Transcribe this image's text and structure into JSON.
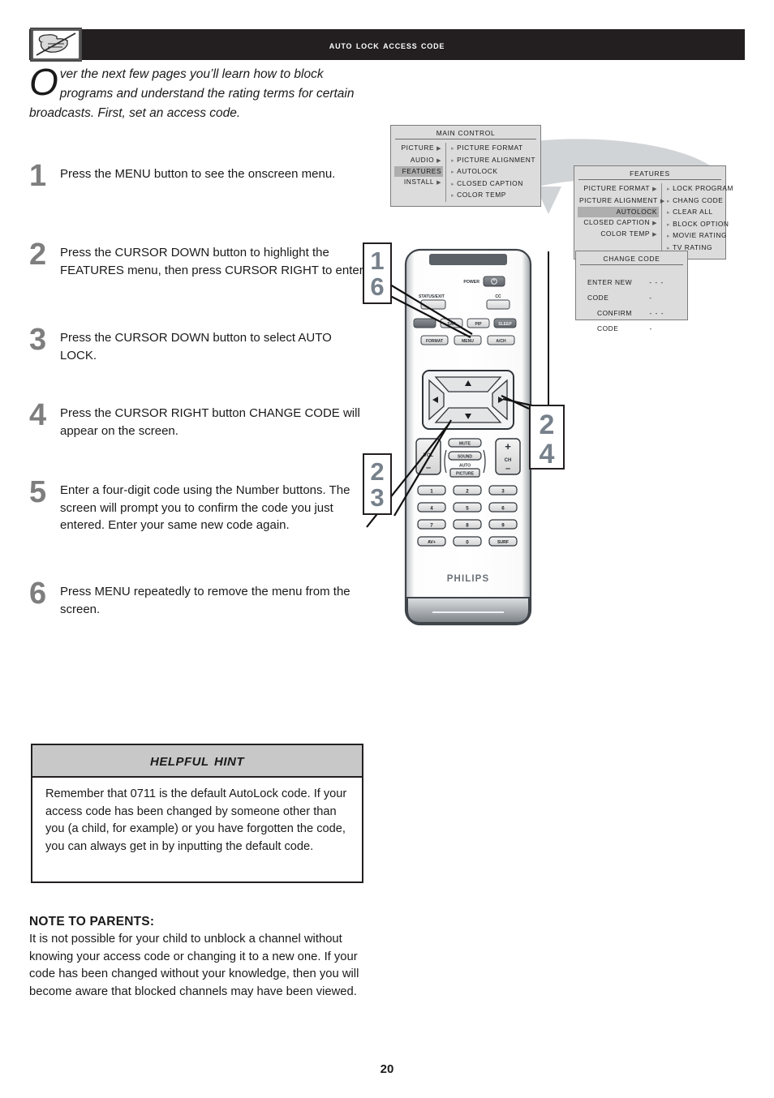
{
  "header": {
    "title": "Auto Lock Access Code",
    "icon": "no-touch-tv-hand-icon"
  },
  "intro": {
    "dropcap": "O",
    "text": "ver the next few pages you’ll learn how to block programs and understand the rating terms for certain broadcasts. First, set an access code."
  },
  "steps": [
    {
      "num": "1",
      "text": "Press the MENU  button to see the onscreen menu."
    },
    {
      "num": "2",
      "text": "Press the CURSOR DOWN button to highlight the FEATURES menu, then press CURSOR RIGHT to enter."
    },
    {
      "num": "3",
      "text": "Press the CURSOR DOWN button to select AUTO LOCK."
    },
    {
      "num": "4",
      "text": "Press the CURSOR RIGHT button CHANGE CODE will appear on the screen."
    },
    {
      "num": "5",
      "text": "Enter a four-digit code using the Number buttons. The screen will prompt you to confirm the code you just entered. Enter your same new code again."
    },
    {
      "num": "6",
      "text": "Press MENU repeatedly to remove the menu from the screen."
    }
  ],
  "osd": {
    "main_control": {
      "title": "MAIN CONTROL",
      "left_items": [
        {
          "label": "PICTURE",
          "arrow": true,
          "selected": false
        },
        {
          "label": "AUDIO",
          "arrow": true,
          "selected": false
        },
        {
          "label": "FEATURES",
          "arrow": false,
          "selected": true
        },
        {
          "label": "INSTALL",
          "arrow": true,
          "selected": false
        }
      ],
      "right_items": [
        "PICTURE FORMAT",
        "PICTURE ALIGNMENT",
        "AUTOLOCK",
        "CLOSED CAPTION",
        "COLOR TEMP"
      ]
    },
    "features": {
      "title": "FEATURES",
      "left_items": [
        {
          "label": "PICTURE FORMAT",
          "arrow": true,
          "selected": false
        },
        {
          "label": "PICTURE ALIGNMENT",
          "arrow": true,
          "selected": false
        },
        {
          "label": "AUTOLOCK",
          "arrow": false,
          "selected": true
        },
        {
          "label": "CLOSED CAPTION",
          "arrow": true,
          "selected": false
        },
        {
          "label": "COLOR TEMP",
          "arrow": true,
          "selected": false
        }
      ],
      "right_items": [
        "LOCK PROGRAM",
        "CHANG CODE",
        "CLEAR ALL",
        "BLOCK OPTION",
        "MOVIE RATING",
        "TV RATING"
      ]
    },
    "change_code": {
      "title": "CHANGE CODE",
      "rows": [
        {
          "label": "ENTER NEW CODE",
          "value": "- - - -"
        },
        {
          "label": "CONFIRM CODE",
          "value": "- - - -"
        }
      ]
    }
  },
  "callouts": [
    {
      "id": "callout-16",
      "lines": [
        "1",
        "6"
      ]
    },
    {
      "id": "callout-23",
      "lines": [
        "2",
        "3"
      ]
    },
    {
      "id": "callout-24",
      "lines": [
        "2",
        "4"
      ]
    }
  ],
  "remote": {
    "brand": "PHILIPS",
    "power_label": "POWER",
    "status_label": "STATUS/EXIT",
    "cc_label": "CC",
    "row_mid": [
      "SAP",
      "PIP",
      "SLEEP"
    ],
    "row_fn": [
      "FORMAT",
      "MENU",
      "A/CH"
    ],
    "mute": "MUTE",
    "sound": "SOUND",
    "auto": "AUTO",
    "picture": "PICTURE",
    "vol": "VOL",
    "ch": "CH",
    "plus": "+",
    "minus": "–",
    "keypad": [
      "1",
      "2",
      "3",
      "4",
      "5",
      "6",
      "7",
      "8",
      "9",
      "AV+",
      "0",
      "SURF"
    ],
    "cursor": {
      "up": "▲",
      "down": "▼",
      "left": "◀",
      "right": "▶"
    }
  },
  "hint": {
    "title": "Helpful Hint",
    "body": "Remember that 0711 is the default AutoLock code. If your access code has been changed by someone other than you (a child, for example) or you have forgotten the code, you can always get in by inputting the default code."
  },
  "note": {
    "title": "NOTE TO PARENTS:",
    "body": "It is not possible for your child to unblock a channel without knowing your access code or changing it to a new one. If your code has been changed without your knowledge, then you will become aware that blocked channels may have been viewed."
  },
  "page_number": "20",
  "colors": {
    "header_bg": "#231f20",
    "osd_bg": "#dcdcdc",
    "osd_sel": "#aeaeae",
    "step_num": "#7e7e7e",
    "callout_num": "#77818c",
    "hint_head": "#c8c8c8"
  }
}
